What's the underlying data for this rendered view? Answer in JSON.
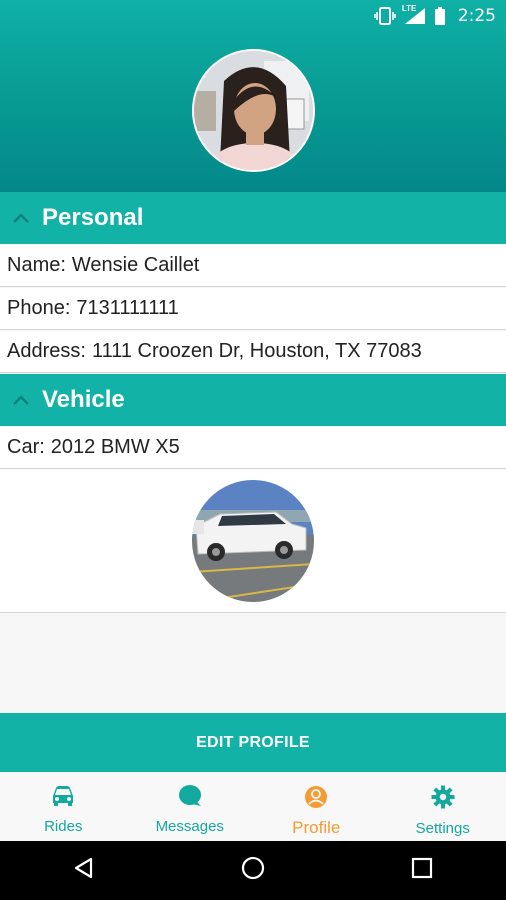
{
  "status_bar": {
    "network": "LTE",
    "time": "2:25"
  },
  "profile": {
    "avatar_icon": "profile-photo",
    "sections": {
      "personal": {
        "title": "Personal",
        "name_label": "Name:",
        "name_value": "Wensie Caillet",
        "phone_label": "Phone:",
        "phone_value": "7131111111",
        "address_label": "Address:",
        "address_value": "1111 Croozen Dr, Houston, TX 77083"
      },
      "vehicle": {
        "title": "Vehicle",
        "car_label": "Car:",
        "car_value": "2012 BMW X5"
      }
    },
    "edit_button": "EDIT PROFILE"
  },
  "tabs": [
    {
      "label": "Rides",
      "icon": "car-icon"
    },
    {
      "label": "Messages",
      "icon": "chat-bubble-icon"
    },
    {
      "label": "Profile",
      "icon": "person-icon",
      "active": true
    },
    {
      "label": "Settings",
      "icon": "gear-icon"
    }
  ],
  "colors": {
    "accent": "#12b2a7",
    "active_tab": "#f39c34",
    "header_dark": "#04878a"
  }
}
